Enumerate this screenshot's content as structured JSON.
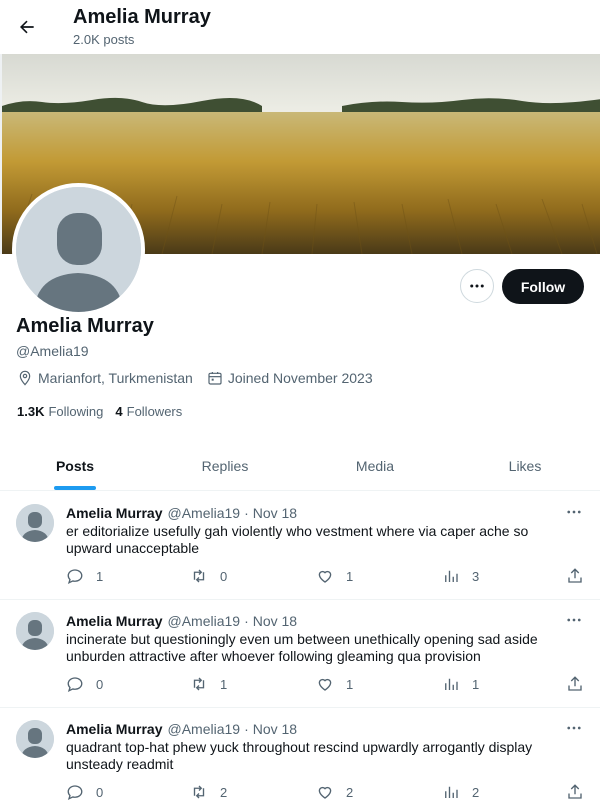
{
  "header": {
    "back_icon": "arrow-left-icon",
    "name": "Amelia Murray",
    "post_count": "2.0K posts"
  },
  "banner": {
    "description_icon": "wheat-field-banner"
  },
  "profile": {
    "name": "Amelia Murray",
    "handle": "@Amelia19",
    "location": "Marianfort, Turkmenistan",
    "joined": "Joined November 2023",
    "following_count": "1.3K",
    "following_label": "Following",
    "followers_count": "4",
    "followers_label": "Followers",
    "follow_label": "Follow"
  },
  "tabs": [
    {
      "label": "Posts",
      "active": true
    },
    {
      "label": "Replies",
      "active": false
    },
    {
      "label": "Media",
      "active": false
    },
    {
      "label": "Likes",
      "active": false
    }
  ],
  "posts": [
    {
      "name": "Amelia Murray",
      "handle": "@Amelia19",
      "dot": "·",
      "date": "Nov 18",
      "text": "er editorialize usefully gah violently who vestment where via caper ache so upward unacceptable",
      "replies": "1",
      "reposts": "0",
      "likes": "1",
      "views": "3"
    },
    {
      "name": "Amelia Murray",
      "handle": "@Amelia19",
      "dot": "·",
      "date": "Nov 18",
      "text": "incinerate but questioningly even um between unethically opening sad aside unburden attractive after whoever following gleaming qua provision",
      "replies": "0",
      "reposts": "1",
      "likes": "1",
      "views": "1"
    },
    {
      "name": "Amelia Murray",
      "handle": "@Amelia19",
      "dot": "·",
      "date": "Nov 18",
      "text": "quadrant top-hat phew yuck throughout rescind upwardly arrogantly display unsteady readmit",
      "replies": "0",
      "reposts": "2",
      "likes": "2",
      "views": "2"
    }
  ],
  "colors": {
    "accent": "#1d9bf0",
    "text": "#0f1419",
    "muted": "#536471",
    "follow_bg": "#0f1419",
    "avatar_bg": "#ccd6dd"
  }
}
